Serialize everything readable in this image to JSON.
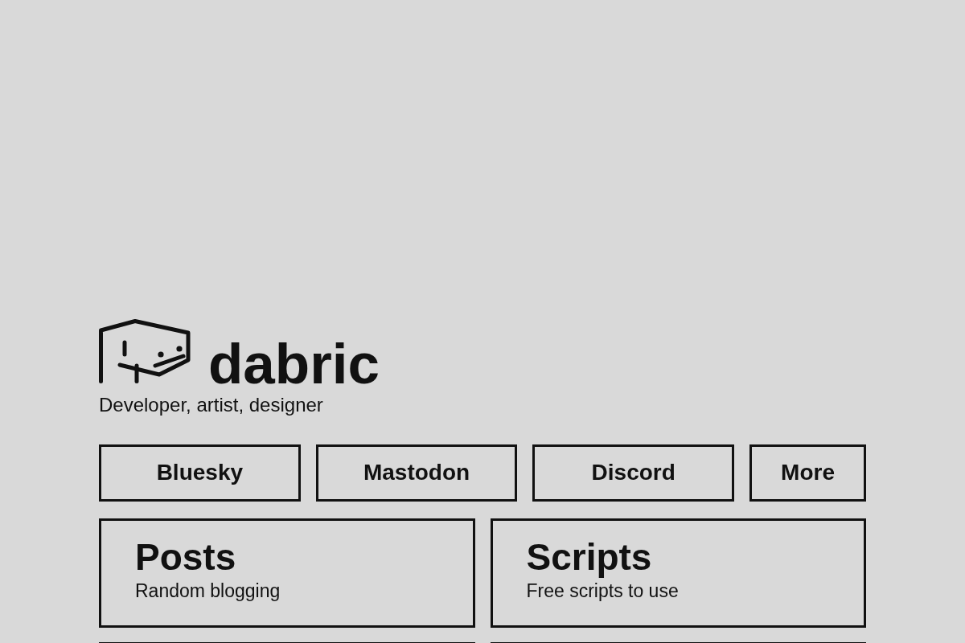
{
  "header": {
    "name": "dabric",
    "tagline": "Developer, artist, designer"
  },
  "links": [
    {
      "label": "Bluesky"
    },
    {
      "label": "Mastodon"
    },
    {
      "label": "Discord"
    },
    {
      "label": "More"
    }
  ],
  "sections": [
    {
      "title": "Posts",
      "description": "Random blogging"
    },
    {
      "title": "Scripts",
      "description": "Free scripts to use"
    }
  ]
}
